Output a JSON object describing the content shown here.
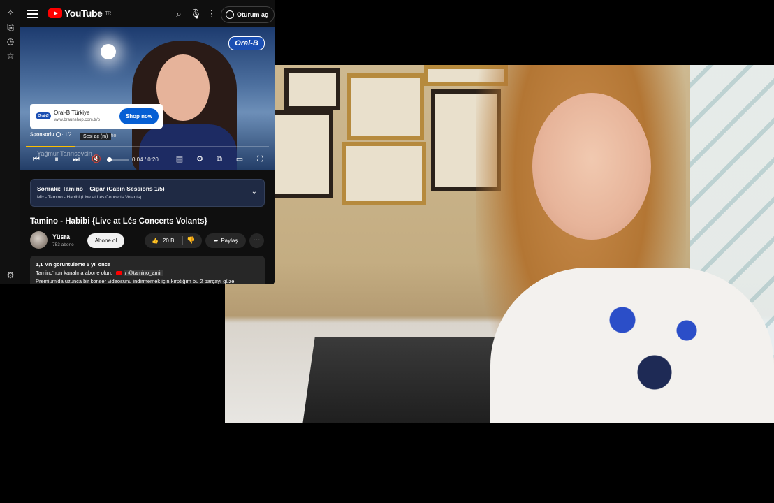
{
  "youtube": {
    "logo_text": "YouTube",
    "logo_region": "TR",
    "sign_in_label": "Oturum aç",
    "ad": {
      "brand_badge": "Oral-B",
      "advertiser": "Oral-B Türkiye",
      "url": "www.braunshop.com.tr/o",
      "cta": "Shop now",
      "sponsor_label": "Sponsorlu",
      "sponsor_count": "· 1/2",
      "tooltip": "Sesi aç (m)",
      "tooltip_tail": "tio",
      "person_name": "Yağmur Tanrısevsin"
    },
    "player": {
      "time": "0:04 / 0:20",
      "progress_fraction": 0.2
    },
    "up_next": {
      "title": "Sonraki: Tamino – Cigar (Cabin Sessions 1/5)",
      "subtitle": "Mix - Tamino - Habibi (Live at Lés Concerts Volants)"
    },
    "video_title": "Tamino - Habibi {Live at Lés Concerts Volants}",
    "channel": {
      "name": "Yüsra",
      "subscribers": "753 abone",
      "subscribe_label": "Abone ol"
    },
    "actions": {
      "likes": "20 B",
      "share_label": "Paylaş"
    },
    "description": {
      "stats": "1,1 Mn görüntüleme  5 yıl önce",
      "line2_prefix": "Tamino'nun kanalına abone olun:",
      "line2_handle": "/ @tamino_amir",
      "line3": "Premium'da uzunca bir konser videosunu indirmemek için kırptığım bu 2 parçayı güzel"
    }
  },
  "colors": {
    "yt_red": "#ff0000",
    "cta_blue": "#065fd4",
    "progress_yellow": "#fcbf00"
  }
}
